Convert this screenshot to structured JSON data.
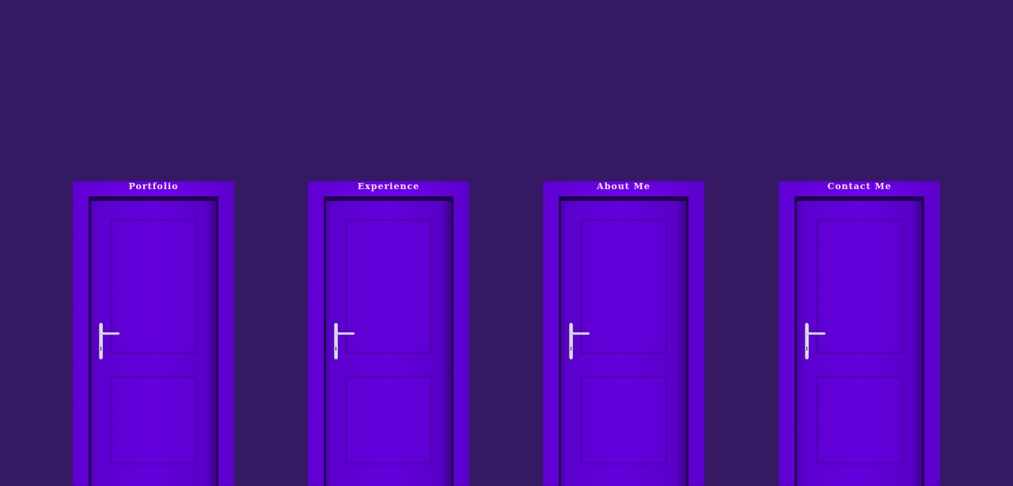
{
  "page": {
    "background_color": "#351a63",
    "door_color": "#6400de"
  },
  "doors": [
    {
      "label": "Portfolio"
    },
    {
      "label": "Experience"
    },
    {
      "label": "About Me"
    },
    {
      "label": "Contact Me"
    }
  ]
}
